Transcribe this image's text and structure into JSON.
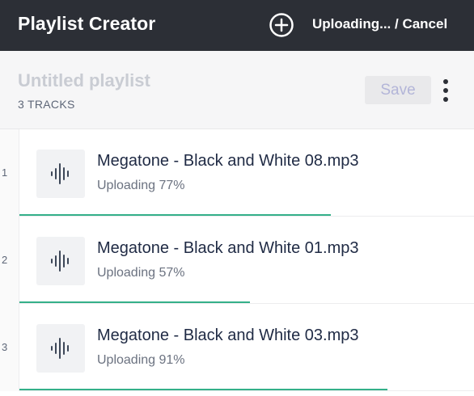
{
  "header": {
    "title": "Playlist Creator",
    "add_icon": "plus-circle-icon",
    "status_text": "Uploading... / Cancel"
  },
  "playlist": {
    "name_placeholder": "Untitled playlist",
    "track_count": "3 TRACKS",
    "save_label": "Save",
    "more_icon": "more-vertical-icon"
  },
  "tracks": [
    {
      "number": "1",
      "title": "Megatone - Black and White 08.mp3",
      "status": "Uploading 77%",
      "progress": 0.77,
      "icon": "audio-waveform-icon"
    },
    {
      "number": "2",
      "title": "Megatone - Black and White 01.mp3",
      "status": "Uploading 57%",
      "progress": 0.57,
      "icon": "audio-waveform-icon"
    },
    {
      "number": "3",
      "title": "Megatone - Black and White 03.mp3",
      "status": "Uploading 91%",
      "progress": 0.91,
      "icon": "audio-waveform-icon"
    }
  ],
  "colors": {
    "header_bg": "#2c2f36",
    "progress": "#34b089",
    "save_text": "#b3b5d8"
  }
}
